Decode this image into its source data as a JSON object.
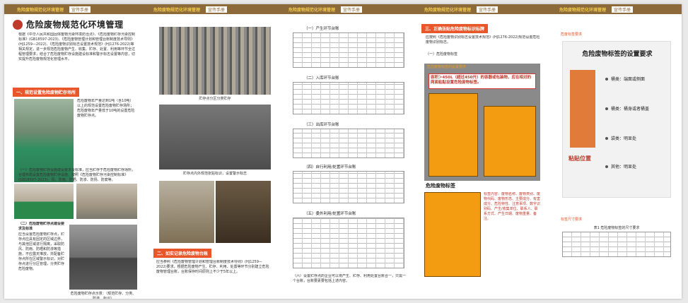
{
  "header": {
    "title": "危险废物规范化环境管理",
    "chip": "宣传手册"
  },
  "panel1": {
    "title": "危险废物规范化环境管理",
    "intro": "根据《中华人民共和国固体废物污染环境防治法》、《危险废物贮存污染控制标准》(GB18597-2023)、《危险废物管理计划和管理台账制度技术导则》(HJ1259—2022)、《危险废物识别标志设置技术规范》(HJ1276-2022)等相关规定，进一步规范危险废物产生、收集、贮存、处置、利用等环节全过程管理要求，结合了危险废物贮存设施建设标准和警示标志设置等内容，切实提升危险废物规范化管理水平。",
    "sec1": "一、规范设置危险废物贮存场所",
    "p1": "危险废物年产量达到1吨（含10吨）以上的规范设置危险废物贮存场所；危险废物年产量低于10吨的设置危险废物贮存点。",
    "p2": "（一）危险废物贮存设施建设要求及标准，应当贮存于危险废物贮存场所，合理布局设置危险废物贮存设施，按照《危险废物贮存污染控制标准》(GB18597-2023)，风、防雨、防晒、防渗、防扬、防腐等。",
    "p3": "（二）危险废物贮存点建设要求及标准",
    "p4": "应当设置危险废物贮存点，贮存点应具有固定的区域边界，与其他区域进行隔离，采取防风、防雨、防晒和防渗等措施，不应露天堆放，并配备贮存点所在区域警示标识，对贮存点进行分区管理，分类贮存危险废物。",
    "cap": "危险废物贮存点示意：（规范贮存、分类、防渗、标识）"
  },
  "panel2": {
    "cap1": "贮存点分区分类贮存",
    "cap2": "贮存点内外规范张贴标识，设置警示标志",
    "sec2": "二、如实记录危险废物台账",
    "p1": "应当参照《危险废物管理计划和管理台账制度技术导则》(HJ1259—2022)要求，根据危险废物产生、贮存、利用、处置等环节分别建立危险废物管理台账，台账保存时间原则上不少于5年以上。"
  },
  "panel3": {
    "t1": "（一）产生环节台账",
    "t2": "（二）入库环节台账",
    "t3": "（三）出库环节台账",
    "t4": "（四）自行利用/处置环节台账",
    "t5": "（五）委外利用/处置环节台账",
    "note": "（六）设置贮存点的企业可以将产生、贮存、利用处置台账合一，只需一个台账，台账要素要包括上述内容。"
  },
  "panel4": {
    "sec3": "三、正确张贴危险废物标识标牌",
    "p1": "应按照《危险废物识别标志设置技术规范》(HJ1276-2022)规范设置危险废物识别标志。",
    "sub": "（一）危险废物标签",
    "warnHeader": "危险废物标签的设置要求",
    "warn1": "容积＞450L（超过450升）的容器或包装物，应在相对的两面粘贴设置危险废物标签。",
    "sample": "危险废物标签",
    "note": "标签内容：废物名称、废物类别、废物代码、废物形态、主要成分、有害成分、危险特性、注意事项、数字识别码、产生/收集单位、联系人、联系方式、产生日期、废物重量、备注。"
  },
  "panel5": {
    "tag1": "危废标签要求",
    "bigTitle": "危险废物标签的设置要求",
    "items": [
      "桶类：端面或侧面",
      "桶类：桶身或者桶盖",
      "袋类：明显处",
      "其他：明显处"
    ],
    "paste": "粘贴位置",
    "tag2": "标签尺寸要求",
    "tableTitle": "表1  危险废物标签的尺寸要求"
  },
  "colors": {
    "accent": "#e8562a",
    "header": "#8c6a3a",
    "orange": "#f39c12"
  }
}
